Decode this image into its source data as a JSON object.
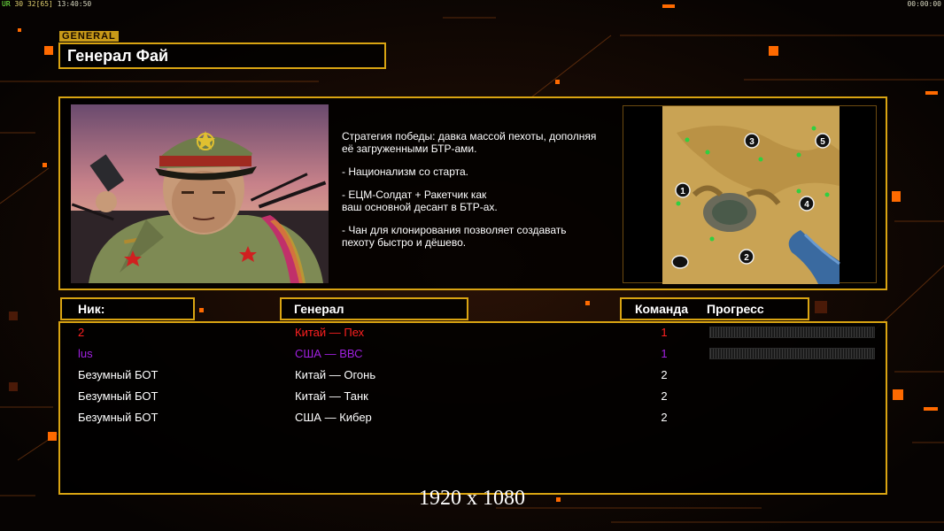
{
  "hud": {
    "left_green": "UR",
    "left_nums": "30",
    "left_num2": "32",
    "left_bracket": "[65]",
    "left_time": "13:40:50",
    "right_time": "00:00:00"
  },
  "general_tag": "GENERAL",
  "general_name": "Генерал Фай",
  "strategy": [
    "Стратегия победы: давка массой пехоты, дополняя\n её загруженными БТР-ами.",
    "- Национализм со старта.",
    "- ЕЦМ-Солдат + Ракетчик как\nваш основной десант в БТР-ах.",
    "- Чан для клонирования позволяет создавать\n пехоту быстро и дёшево."
  ],
  "map": {
    "start_positions": [
      "1",
      "2",
      "3",
      "4",
      "5"
    ]
  },
  "headers": {
    "nick": "Ник:",
    "general": "Генерал",
    "team": "Команда",
    "progress": "Прогресс"
  },
  "players": [
    {
      "nick": "2",
      "general": "Китай — Пех",
      "team": "1",
      "color": "#ff2020",
      "has_progress": true
    },
    {
      "nick": "lus",
      "general": "США — ВВС",
      "team": "1",
      "color": "#a020e0",
      "has_progress": true
    },
    {
      "nick": "Безумный БОТ",
      "general": "Китай — Огонь",
      "team": "2",
      "color": "#ffffff",
      "has_progress": false
    },
    {
      "nick": "Безумный БОТ",
      "general": "Китай — Танк",
      "team": "2",
      "color": "#ffffff",
      "has_progress": false
    },
    {
      "nick": "Безумный БОТ",
      "general": "США — Кибер",
      "team": "2",
      "color": "#ffffff",
      "has_progress": false
    }
  ],
  "resolution_label": "1920 x 1080",
  "colors": {
    "accent": "#d9a412",
    "orange_dot": "#ff6a00"
  }
}
